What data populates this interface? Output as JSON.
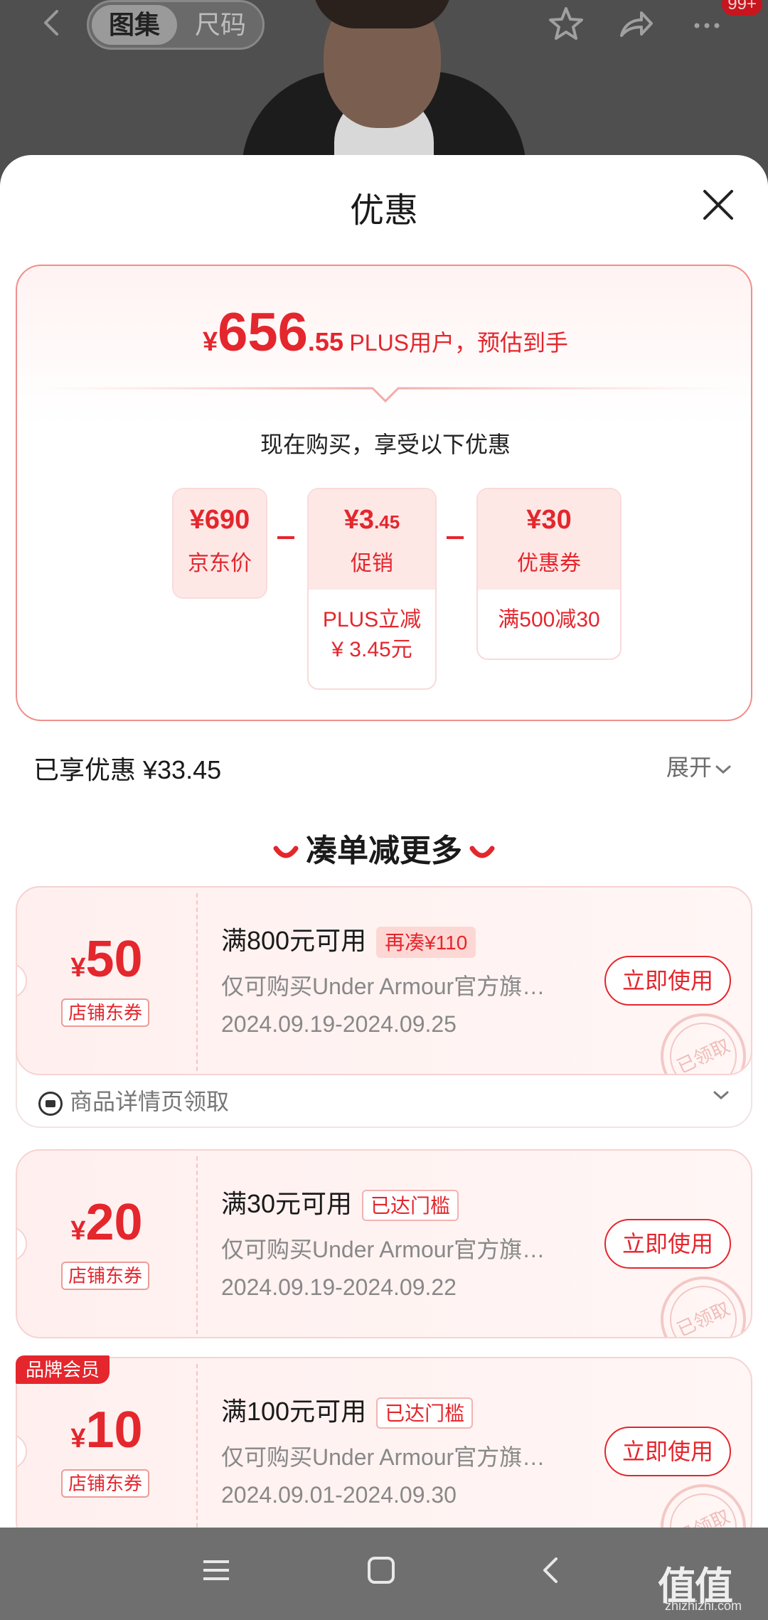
{
  "header": {
    "tab_active": "图集",
    "tab_inactive": "尺码",
    "badge": "99+"
  },
  "sheet": {
    "title": "优惠"
  },
  "summary": {
    "yen": "¥",
    "price_int": "656",
    "price_dec": ".55",
    "price_label": "PLUS用户，预估到手",
    "buy_now": "现在购买，享受以下优惠",
    "chips": [
      {
        "amount": "¥690",
        "label": "京东价",
        "note": ""
      },
      {
        "amount_int": "¥3",
        "amount_dec": ".45",
        "label": "促销",
        "note": "PLUS立减\n¥ 3.45元"
      },
      {
        "amount": "¥30",
        "label": "优惠券",
        "note": "满500减30"
      }
    ],
    "chip1_amount": "¥690",
    "chip1_label": "京东价",
    "chip2_amount_int": "¥3",
    "chip2_amount_dec": ".45",
    "chip2_label": "促销",
    "chip2_note_1": "PLUS立减",
    "chip2_note_2": "¥ 3.45元",
    "chip3_amount": "¥30",
    "chip3_label": "优惠券",
    "chip3_note": "满500减30"
  },
  "saved": {
    "text": "已享优惠 ¥33.45",
    "expand": "展开"
  },
  "more": {
    "title": "凑单减更多"
  },
  "coupons": [
    {
      "yen": "¥",
      "value": "50",
      "tag": "店铺东券",
      "condition": "满800元可用",
      "pill": "再凑¥110",
      "desc": "仅可购买Under Armour官方旗…",
      "date": "2024.09.19-2024.09.25",
      "action": "立即使用",
      "stamp": "已领取",
      "source": "商品详情页领取"
    },
    {
      "yen": "¥",
      "value": "20",
      "tag": "店铺东券",
      "condition": "满30元可用",
      "pill": "已达门槛",
      "desc": "仅可购买Under Armour官方旗…",
      "date": "2024.09.19-2024.09.22",
      "action": "立即使用",
      "stamp": "已领取"
    },
    {
      "badge": "品牌会员",
      "yen": "¥",
      "value": "10",
      "tag": "店铺东券",
      "condition": "满100元可用",
      "pill": "已达门槛",
      "desc": "仅可购买Under Armour官方旗…",
      "date": "2024.09.01-2024.09.30",
      "action": "立即使用",
      "stamp": "已领取"
    }
  ],
  "watermark": {
    "logo": "值值值",
    "url": "zhizhizhi.com"
  },
  "colors": {
    "accent": "#e4262d",
    "chip_bg": "#fde8e6",
    "nav_bg": "#6f6f6f"
  }
}
